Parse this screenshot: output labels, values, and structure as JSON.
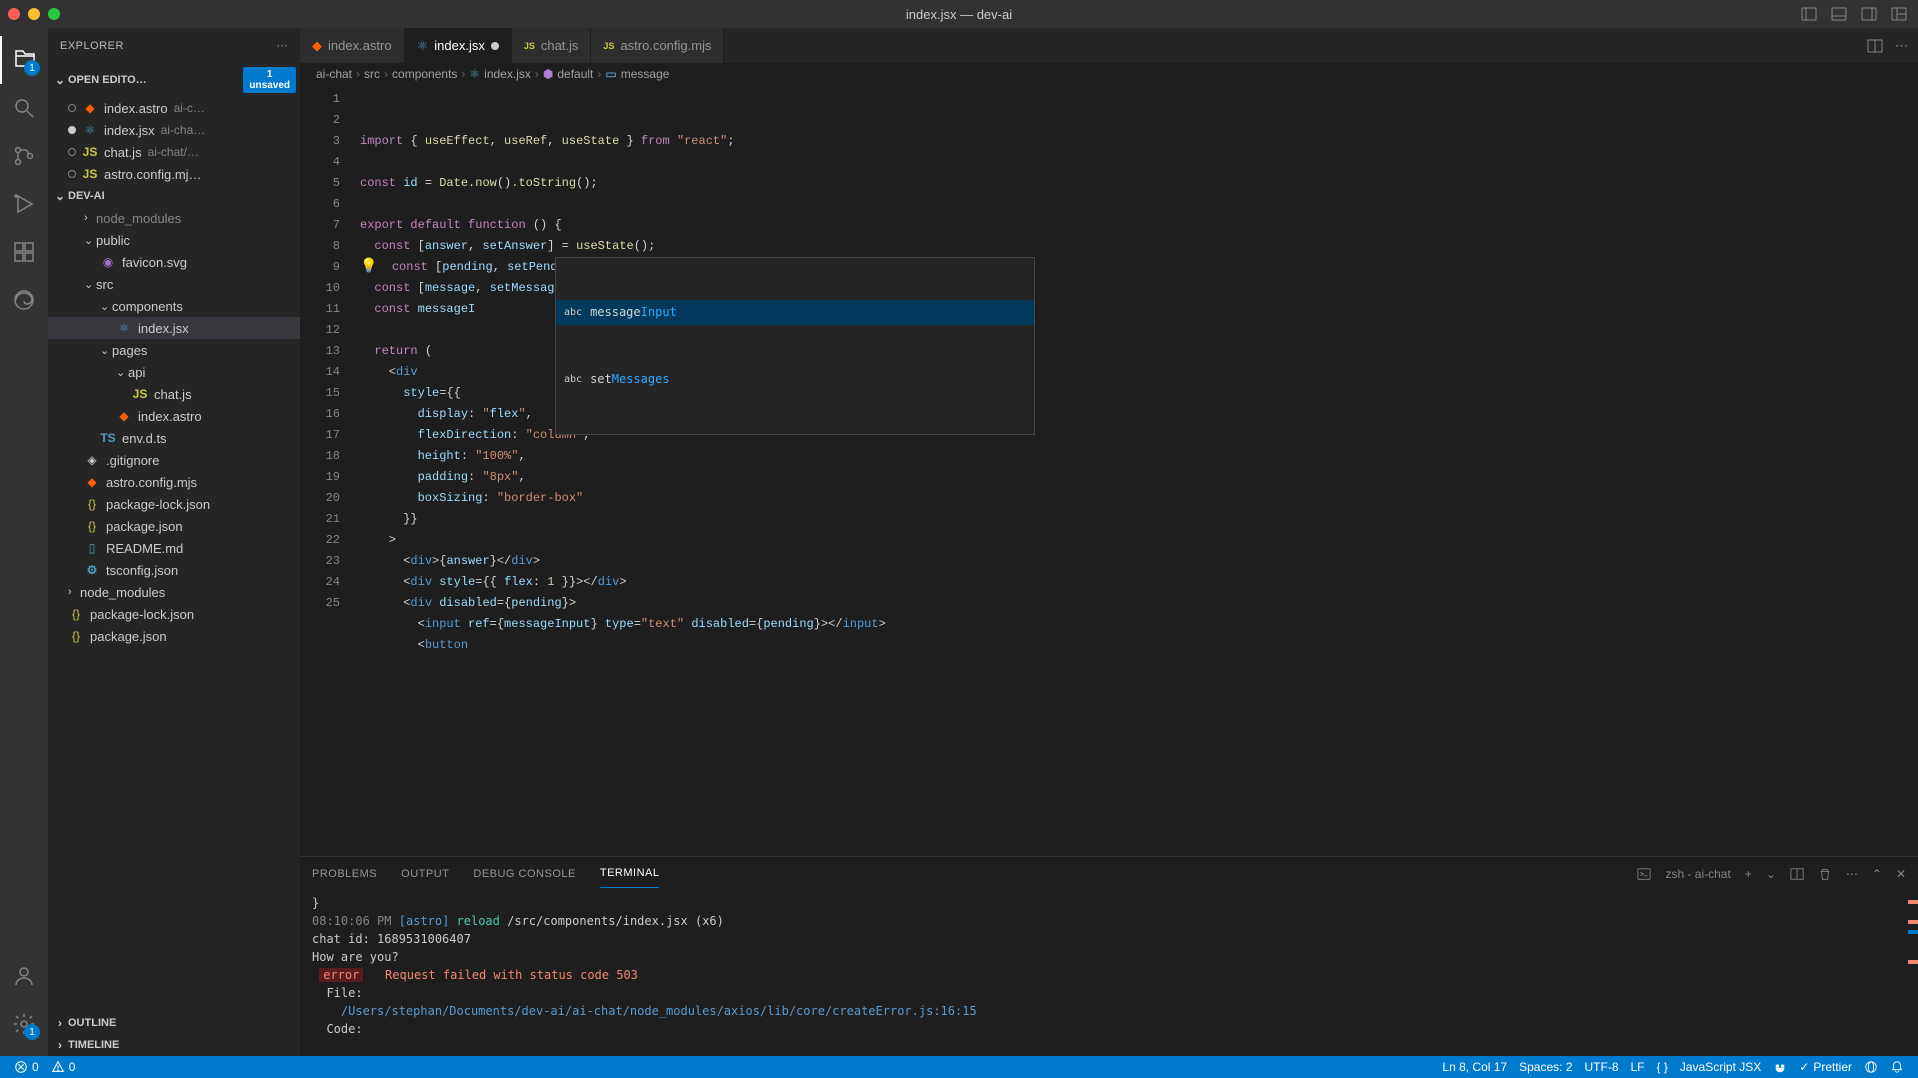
{
  "window": {
    "title": "index.jsx — dev-ai"
  },
  "activity": {
    "badge_explorer": "1",
    "badge_settings": "1"
  },
  "sidebar": {
    "title": "EXPLORER",
    "openEditors": {
      "label": "OPEN EDITO…",
      "unsaved_count": "1",
      "unsaved_label": "unsaved",
      "items": [
        {
          "name": "index.astro",
          "hint": "ai-c…",
          "modified": false
        },
        {
          "name": "index.jsx",
          "hint": "ai-cha…",
          "modified": true
        },
        {
          "name": "chat.js",
          "hint": "ai-chat/…",
          "modified": false
        },
        {
          "name": "astro.config.mj…",
          "hint": "",
          "modified": false
        }
      ]
    },
    "projectName": "DEV-AI",
    "tree": [
      {
        "type": "folder",
        "name": "node_modules",
        "indent": 2,
        "open": false,
        "dim": true
      },
      {
        "type": "folder",
        "name": "public",
        "indent": 2,
        "open": true
      },
      {
        "type": "file",
        "name": "favicon.svg",
        "indent": 3,
        "icon": "svg"
      },
      {
        "type": "folder",
        "name": "src",
        "indent": 2,
        "open": true
      },
      {
        "type": "folder",
        "name": "components",
        "indent": 3,
        "open": true
      },
      {
        "type": "file",
        "name": "index.jsx",
        "indent": 4,
        "icon": "react",
        "active": true
      },
      {
        "type": "folder",
        "name": "pages",
        "indent": 3,
        "open": true
      },
      {
        "type": "folder",
        "name": "api",
        "indent": 4,
        "open": true
      },
      {
        "type": "file",
        "name": "chat.js",
        "indent": 5,
        "icon": "js"
      },
      {
        "type": "file",
        "name": "index.astro",
        "indent": 4,
        "icon": "astro"
      },
      {
        "type": "file",
        "name": "env.d.ts",
        "indent": 3,
        "icon": "ts"
      },
      {
        "type": "file",
        "name": ".gitignore",
        "indent": 2,
        "icon": "git"
      },
      {
        "type": "file",
        "name": "astro.config.mjs",
        "indent": 2,
        "icon": "astro"
      },
      {
        "type": "file",
        "name": "package-lock.json",
        "indent": 2,
        "icon": "json"
      },
      {
        "type": "file",
        "name": "package.json",
        "indent": 2,
        "icon": "json"
      },
      {
        "type": "file",
        "name": "README.md",
        "indent": 2,
        "icon": "md"
      },
      {
        "type": "file",
        "name": "tsconfig.json",
        "indent": 2,
        "icon": "tsconfig"
      },
      {
        "type": "folder",
        "name": "node_modules",
        "indent": 1,
        "open": false
      },
      {
        "type": "file",
        "name": "package-lock.json",
        "indent": 1,
        "icon": "json"
      },
      {
        "type": "file",
        "name": "package.json",
        "indent": 1,
        "icon": "json"
      }
    ],
    "outline": "OUTLINE",
    "timeline": "TIMELINE"
  },
  "tabs": [
    {
      "name": "index.astro",
      "icon": "astro",
      "active": false,
      "modified": false
    },
    {
      "name": "index.jsx",
      "icon": "react",
      "active": true,
      "modified": true
    },
    {
      "name": "chat.js",
      "icon": "js",
      "active": false,
      "modified": false
    },
    {
      "name": "astro.config.mjs",
      "icon": "js",
      "active": false,
      "modified": false
    }
  ],
  "breadcrumb": [
    "ai-chat",
    "src",
    "components",
    "index.jsx",
    "default",
    "message"
  ],
  "code": {
    "lines": [
      "import { useEffect, useRef, useState } from \"react\";",
      "",
      "const id = Date.now().toString();",
      "",
      "export default function () {",
      "  const [answer, setAnswer] = useState();",
      "  const [pending, setPending] = useState();",
      "  const [message, setMessages] = useState();",
      "  const messageI",
      "",
      "  return (",
      "    <div",
      "      style={{",
      "        display: \"flex\",",
      "        flexDirection: \"column\",",
      "        height: \"100%\",",
      "        padding: \"8px\",",
      "        boxSizing: \"border-box\"",
      "      }}",
      "    >",
      "      <div>{answer}</div>",
      "      <div style={{ flex: 1 }}></div>",
      "      <div disabled={pending}>",
      "        <input ref={messageInput} type=\"text\" disabled={pending}></input>",
      "        <button"
    ],
    "lineStart": 1,
    "suggest": [
      {
        "label_pre": "message",
        "label_hl": "Input",
        "prefix": "abc"
      },
      {
        "label_pre": "set",
        "label_hl": "Messages",
        "prefix": "abc"
      }
    ]
  },
  "panel": {
    "tabs": [
      "PROBLEMS",
      "OUTPUT",
      "DEBUG CONSOLE",
      "TERMINAL"
    ],
    "activeTab": 3,
    "terminalLabel": "zsh - ai-chat",
    "terminal": {
      "brace": "}",
      "time": "08:10:06 PM",
      "astro": "[astro]",
      "reload": "reload",
      "reloadPath": "/src/components/index.jsx (x6)",
      "chatId": "chat id: 1689531006407",
      "howAreYou": "How are you?",
      "errorBadge": "error",
      "errorMsg": "Request failed with status code 503",
      "fileLabel": "File:",
      "filePath": "/Users/stephan/Documents/dev-ai/ai-chat/node_modules/axios/lib/core/createError.js:16:15",
      "codeLabel": "Code:"
    }
  },
  "status": {
    "errors": "0",
    "warnings": "0",
    "cursor": "Ln 8, Col 17",
    "spaces": "Spaces: 2",
    "encoding": "UTF-8",
    "eol": "LF",
    "lang": "JavaScript JSX",
    "prettier": "Prettier"
  }
}
